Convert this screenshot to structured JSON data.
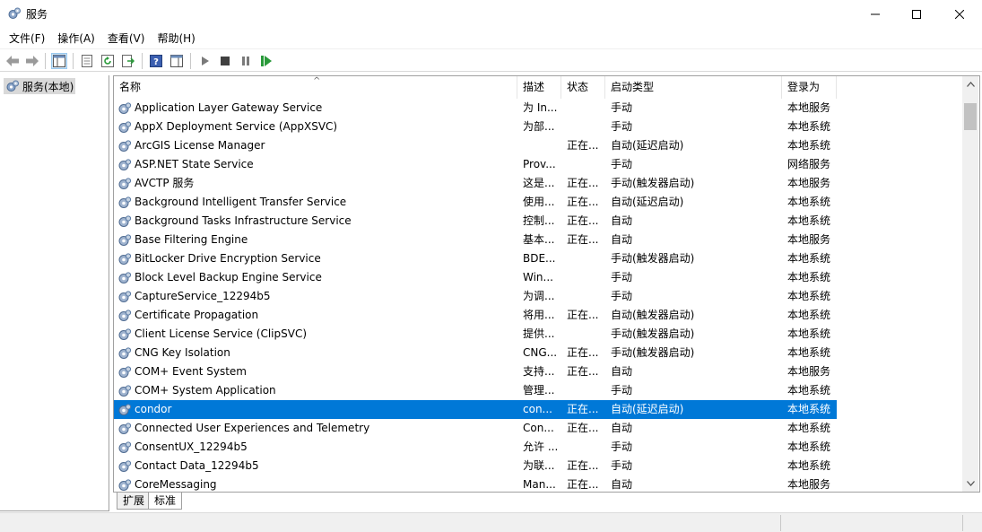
{
  "window": {
    "title": "服务"
  },
  "menu": [
    "文件(F)",
    "操作(A)",
    "查看(V)",
    "帮助(H)"
  ],
  "tree": {
    "root_label": "服务(本地)"
  },
  "columns": {
    "name": "名称",
    "description": "描述",
    "status": "状态",
    "startup_type": "启动类型",
    "logon_as": "登录为"
  },
  "services": [
    {
      "name": "Application Layer Gateway Service",
      "description": "为 In...",
      "status": "",
      "startup_type": "手动",
      "logon_as": "本地服务"
    },
    {
      "name": "AppX Deployment Service (AppXSVC)",
      "description": "为部...",
      "status": "",
      "startup_type": "手动",
      "logon_as": "本地系统"
    },
    {
      "name": "ArcGIS License Manager",
      "description": "",
      "status": "正在...",
      "startup_type": "自动(延迟启动)",
      "logon_as": "本地系统"
    },
    {
      "name": "ASP.NET State Service",
      "description": "Prov...",
      "status": "",
      "startup_type": "手动",
      "logon_as": "网络服务"
    },
    {
      "name": "AVCTP 服务",
      "description": "这是...",
      "status": "正在...",
      "startup_type": "手动(触发器启动)",
      "logon_as": "本地服务"
    },
    {
      "name": "Background Intelligent Transfer Service",
      "description": "使用...",
      "status": "正在...",
      "startup_type": "自动(延迟启动)",
      "logon_as": "本地系统"
    },
    {
      "name": "Background Tasks Infrastructure Service",
      "description": "控制...",
      "status": "正在...",
      "startup_type": "自动",
      "logon_as": "本地系统"
    },
    {
      "name": "Base Filtering Engine",
      "description": "基本...",
      "status": "正在...",
      "startup_type": "自动",
      "logon_as": "本地服务"
    },
    {
      "name": "BitLocker Drive Encryption Service",
      "description": "BDE...",
      "status": "",
      "startup_type": "手动(触发器启动)",
      "logon_as": "本地系统"
    },
    {
      "name": "Block Level Backup Engine Service",
      "description": "Win...",
      "status": "",
      "startup_type": "手动",
      "logon_as": "本地系统"
    },
    {
      "name": "CaptureService_12294b5",
      "description": "为调...",
      "status": "",
      "startup_type": "手动",
      "logon_as": "本地系统"
    },
    {
      "name": "Certificate Propagation",
      "description": "将用...",
      "status": "正在...",
      "startup_type": "自动(触发器启动)",
      "logon_as": "本地系统"
    },
    {
      "name": "Client License Service (ClipSVC)",
      "description": "提供...",
      "status": "",
      "startup_type": "手动(触发器启动)",
      "logon_as": "本地系统"
    },
    {
      "name": "CNG Key Isolation",
      "description": "CNG...",
      "status": "正在...",
      "startup_type": "手动(触发器启动)",
      "logon_as": "本地系统"
    },
    {
      "name": "COM+ Event System",
      "description": "支持...",
      "status": "正在...",
      "startup_type": "自动",
      "logon_as": "本地服务"
    },
    {
      "name": "COM+ System Application",
      "description": "管理...",
      "status": "",
      "startup_type": "手动",
      "logon_as": "本地系统"
    },
    {
      "name": "condor",
      "description": "con...",
      "status": "正在...",
      "startup_type": "自动(延迟启动)",
      "logon_as": "本地系统",
      "selected": true
    },
    {
      "name": "Connected User Experiences and Telemetry",
      "description": "Con...",
      "status": "正在...",
      "startup_type": "自动",
      "logon_as": "本地系统"
    },
    {
      "name": "ConsentUX_12294b5",
      "description": "允许 ...",
      "status": "",
      "startup_type": "手动",
      "logon_as": "本地系统"
    },
    {
      "name": "Contact Data_12294b5",
      "description": "为联...",
      "status": "正在...",
      "startup_type": "手动",
      "logon_as": "本地系统"
    },
    {
      "name": "CoreMessaging",
      "description": "Man...",
      "status": "正在...",
      "startup_type": "自动",
      "logon_as": "本地服务"
    }
  ],
  "tabs": [
    "扩展",
    "标准"
  ],
  "colors": {
    "selection": "#0078d7",
    "toolbar_pressed": "#cce4f7"
  }
}
